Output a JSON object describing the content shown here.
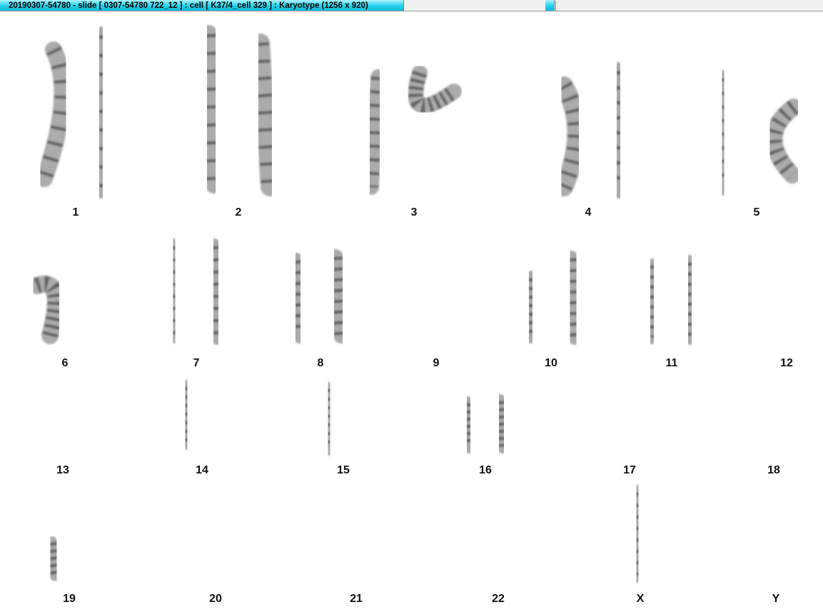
{
  "window": {
    "title": "20190307-54780 - slide [ 0307-54780 722_12 ] : cell [ K37/4_cell 329 ] : Karyotype  (1256 x 920)"
  },
  "karyotype": {
    "band_color": "#2a2a2a",
    "chromosome_color": "#8f8f8f",
    "groups": [
      {
        "label": "1"
      },
      {
        "label": "2"
      },
      {
        "label": "3"
      },
      {
        "label": "4"
      },
      {
        "label": "5"
      },
      {
        "label": "6"
      },
      {
        "label": "7"
      },
      {
        "label": "8"
      },
      {
        "label": "9"
      },
      {
        "label": "10"
      },
      {
        "label": "11"
      },
      {
        "label": "12"
      },
      {
        "label": "13"
      },
      {
        "label": "14"
      },
      {
        "label": "15"
      },
      {
        "label": "16"
      },
      {
        "label": "17"
      },
      {
        "label": "18"
      },
      {
        "label": "19"
      },
      {
        "label": "20"
      },
      {
        "label": "21"
      },
      {
        "label": "22"
      },
      {
        "label": "X"
      },
      {
        "label": "Y"
      }
    ]
  }
}
